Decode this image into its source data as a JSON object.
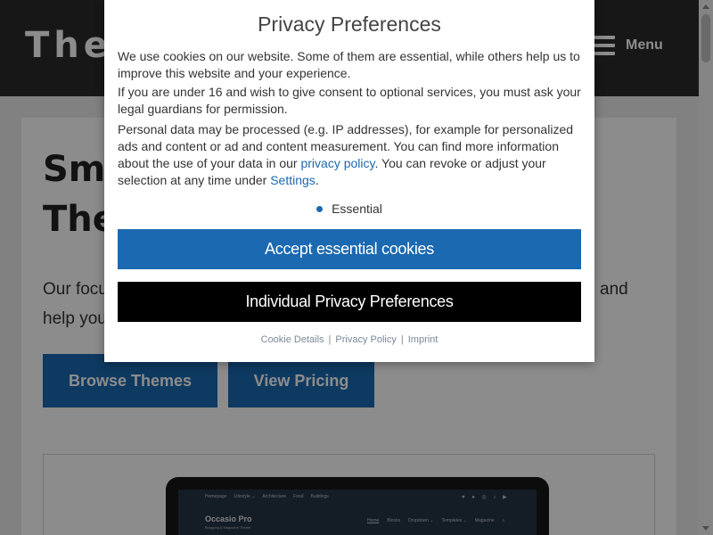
{
  "header": {
    "brand": "The",
    "menu_label": "Menu",
    "menu_icon": "hamburger-icon",
    "background_color": "#2a2a2a"
  },
  "hero": {
    "title_line1": "Sma",
    "title_line2": "The",
    "text_line1_start": "Our focu",
    "text_line1_end": "and",
    "text_line2_start": "help you",
    "browse_button": "Browse Themes",
    "pricing_button": "View Pricing",
    "button_color": "#1b69b0"
  },
  "preview": {
    "nav_items": [
      "Homepage",
      "Lifestyle ⌄",
      "Architecture",
      "Food",
      "Buildings"
    ],
    "social_icons": "♥ ● ◎ ♪ ▶",
    "theme_title": "Occasio Pro",
    "theme_subtitle": "Blogging & Magazine Theme",
    "menu_items": [
      "Home",
      "Blocks",
      "Dropdown ⌄",
      "Templates ⌄",
      "Magazine",
      "⌕"
    ]
  },
  "privacy_dialog": {
    "title": "Privacy Preferences",
    "paragraph1": "We use cookies on our website. Some of them are essential, while others help us to improve this website and your experience.",
    "paragraph2": "If you are under 16 and wish to give consent to optional services, you must ask your legal guardians for permission.",
    "paragraph3_part1": "Personal data may be processed (e.g. IP addresses), for example for personalized ads and content or ad and content measurement. You can find more information about the use of your data in our ",
    "privacy_policy_link": "privacy policy",
    "paragraph3_part2": ". You can revoke or adjust your selection at any time under ",
    "settings_link": "Settings",
    "paragraph3_end": ".",
    "essential_label": "Essential",
    "accept_button": "Accept essential cookies",
    "individual_button": "Individual Privacy Preferences",
    "footer_links": {
      "cookie_details": "Cookie Details",
      "privacy_policy": "Privacy Policy",
      "imprint": "Imprint",
      "separator": "|"
    },
    "accent_color": "#1b69b0"
  },
  "scrollbar": {
    "up_icon": "scroll-up-arrow-icon",
    "down_icon": "scroll-down-arrow-icon"
  }
}
